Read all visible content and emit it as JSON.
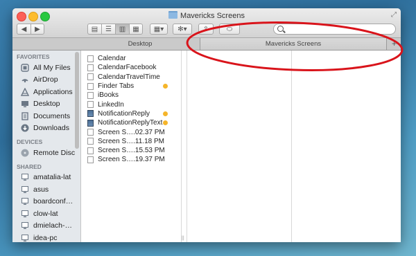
{
  "window": {
    "title": "Mavericks Screens"
  },
  "toolbar": {
    "back": "◀",
    "forward": "▶",
    "view_icon": "▤",
    "view_list": "☰",
    "view_columns": "▥",
    "view_coverflow": "▦",
    "arrange": "▦▾",
    "action": "✻▾",
    "share": "⇪",
    "tags": "⬭",
    "search_placeholder": ""
  },
  "tabs": [
    {
      "label": "Desktop",
      "active": false
    },
    {
      "label": "Mavericks Screens",
      "active": true
    }
  ],
  "tab_add_label": "+",
  "sidebar": {
    "favorites_header": "FAVORITES",
    "favorites": [
      {
        "label": "All My Files",
        "icon": "all-files-icon"
      },
      {
        "label": "AirDrop",
        "icon": "airdrop-icon"
      },
      {
        "label": "Applications",
        "icon": "applications-icon"
      },
      {
        "label": "Desktop",
        "icon": "desktop-icon"
      },
      {
        "label": "Documents",
        "icon": "documents-icon"
      },
      {
        "label": "Downloads",
        "icon": "downloads-icon"
      }
    ],
    "devices_header": "DEVICES",
    "devices": [
      {
        "label": "Remote Disc",
        "icon": "disc-icon"
      }
    ],
    "shared_header": "SHARED",
    "shared": [
      {
        "label": "amatalia-lat",
        "icon": "computer-icon"
      },
      {
        "label": "asus",
        "icon": "computer-icon"
      },
      {
        "label": "boardconf…",
        "icon": "computer-icon"
      },
      {
        "label": "clow-lat",
        "icon": "computer-icon"
      },
      {
        "label": "dmielach-…",
        "icon": "computer-icon"
      },
      {
        "label": "idea-pc",
        "icon": "computer-icon"
      }
    ]
  },
  "files": [
    {
      "name": "Calendar",
      "kind": "doc",
      "tag": false
    },
    {
      "name": "CalendarFacebook",
      "kind": "doc",
      "tag": false
    },
    {
      "name": "CalendarTravelTime",
      "kind": "doc",
      "tag": false
    },
    {
      "name": "Finder Tabs",
      "kind": "doc",
      "tag": true
    },
    {
      "name": "iBooks",
      "kind": "doc",
      "tag": false
    },
    {
      "name": "LinkedIn",
      "kind": "doc",
      "tag": false
    },
    {
      "name": "NotificationReply",
      "kind": "img",
      "tag": true
    },
    {
      "name": "NotificationReplyText",
      "kind": "img",
      "tag": true
    },
    {
      "name": "Screen S….02.37 PM",
      "kind": "doc",
      "tag": false
    },
    {
      "name": "Screen S….11.18 PM",
      "kind": "doc",
      "tag": false
    },
    {
      "name": "Screen S….15.53 PM",
      "kind": "doc",
      "tag": false
    },
    {
      "name": "Screen S….19.37 PM",
      "kind": "doc",
      "tag": false
    }
  ],
  "colors": {
    "tag": "#f5b52a",
    "annotation": "#d9141b"
  }
}
